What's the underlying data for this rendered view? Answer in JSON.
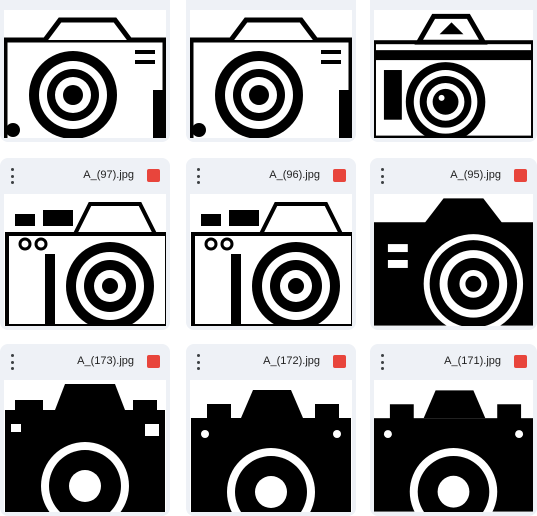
{
  "grid": {
    "row1": [
      {
        "file": "",
        "icon": "image-file-icon"
      },
      {
        "file": "",
        "icon": "image-file-icon"
      },
      {
        "file": "",
        "icon": "image-file-icon"
      }
    ],
    "row2": [
      {
        "file": "A_(97).jpg",
        "icon": "image-file-icon"
      },
      {
        "file": "A_(96).jpg",
        "icon": "image-file-icon"
      },
      {
        "file": "A_(95).jpg",
        "icon": "image-file-icon"
      }
    ],
    "row3": [
      {
        "file": "A_(173).jpg",
        "icon": "image-file-icon"
      },
      {
        "file": "A_(172).jpg",
        "icon": "image-file-icon"
      },
      {
        "file": "A_(171).jpg",
        "icon": "image-file-icon"
      }
    ]
  },
  "colors": {
    "card_bg": "#eef1f6",
    "image_icon": "#e8453c"
  }
}
